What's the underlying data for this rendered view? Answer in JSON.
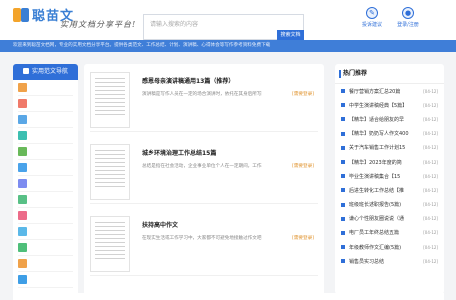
{
  "header": {
    "logo_text": "聪苗文",
    "slogan": "实用文档分享平台!",
    "search_placeholder": "请输入搜索的内容",
    "search_button": "搜索文档",
    "btn_feedback": "投诉建议",
    "btn_login": "登录/注册"
  },
  "nav": {
    "text": "欢迎来到聪苗文档网，专业的实用文档分享平台。提供各类范文、工作总结、计划、演讲稿、心得体会等写作参考资料免费下载"
  },
  "sidebar": {
    "title": "实用范文导航",
    "items": [
      {
        "color": "#f0a24a"
      },
      {
        "color": "#f07a6a"
      },
      {
        "color": "#5aa7e6"
      },
      {
        "color": "#3cbfb1"
      },
      {
        "color": "#69b95a"
      },
      {
        "color": "#4aa3ea"
      },
      {
        "color": "#7d8cf0"
      },
      {
        "color": "#58c086"
      },
      {
        "color": "#ec6b89"
      },
      {
        "color": "#5bb8e8"
      },
      {
        "color": "#4fbf7a"
      },
      {
        "color": "#f0a24a"
      },
      {
        "color": "#3e9ee6"
      }
    ]
  },
  "docs": [
    {
      "title": "感恩母亲演讲稿通用13篇（推荐）",
      "desc": "演讲稿是写作人员在一定的场合演讲时，依托在其身后所写的文书，在…",
      "date": "[需要登录]"
    },
    {
      "title": "城乡环境治理工作总结15篇",
      "desc": "总结是指在社会活动，企业事业单位个人在一定期间，工作、学习或思想…",
      "date": "[需要登录]"
    },
    {
      "title": "扶持高中作文",
      "desc": "在现实生活或工作学习中，大家都不可避免地接触过作文吧，借助作文可以…",
      "date": "[需要登录]"
    }
  ],
  "hot": {
    "title": "热门推荐",
    "items": [
      {
        "t": "餐厅营销方案汇总20篇",
        "d": "[04-12]"
      },
      {
        "t": "中学生演讲稿经典【5篇】",
        "d": "[04-12]"
      },
      {
        "t": "【精华】适合给朋友的早",
        "d": "[04-12]"
      },
      {
        "t": "【精华】奶奶写人作文400",
        "d": "[04-12]"
      },
      {
        "t": "关于汽车销售工作计划15",
        "d": "[04-12]"
      },
      {
        "t": "【精华】2023年度的简",
        "d": "[04-12]"
      },
      {
        "t": "毕业生演讲稿集合【15",
        "d": "[04-12]"
      },
      {
        "t": "后进生转化工作总结【推",
        "d": "[04-12]"
      },
      {
        "t": "班级班长述职报告(5篇)",
        "d": "[04-12]"
      },
      {
        "t": "谦心个性朋友圈说说（通",
        "d": "[04-12]"
      },
      {
        "t": "电厂员工年终总结五篇",
        "d": "[04-12]"
      },
      {
        "t": "年级教师作文汇编(5篇)",
        "d": "[04-12]"
      },
      {
        "t": "销售员实习总结",
        "d": "[04-12]"
      }
    ]
  }
}
